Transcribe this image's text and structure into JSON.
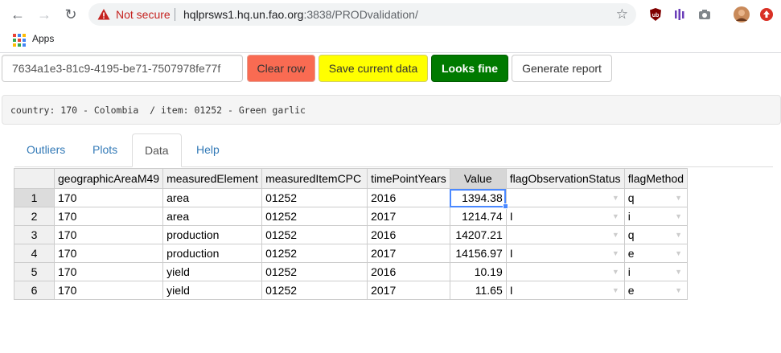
{
  "browser": {
    "security_label": "Not secure",
    "url_host": "hqlprsws1.hq.un.fao.org",
    "url_path": ":3838/PRODvalidation/",
    "bookmarks_apps": "Apps"
  },
  "controls": {
    "record_id": "7634a1e3-81c9-4195-be71-7507978fe77f",
    "clear_row": "Clear row",
    "save_current": "Save current data",
    "looks_fine": "Looks fine",
    "generate_report": "Generate report"
  },
  "info": "country: 170 - Colombia  / item: 01252 - Green garlic",
  "tabs": [
    {
      "label": "Outliers"
    },
    {
      "label": "Plots"
    },
    {
      "label": "Data"
    },
    {
      "label": "Help"
    }
  ],
  "grid": {
    "columns": [
      "geographicAreaM49",
      "measuredElement",
      "measuredItemCPC",
      "timePointYears",
      "Value",
      "flagObservationStatus",
      "flagMethod"
    ],
    "rows": [
      {
        "n": "1",
        "geo": "170",
        "element": "area",
        "cpc": "01252",
        "year": "2016",
        "value": "1394.38",
        "obs": "",
        "method": "q"
      },
      {
        "n": "2",
        "geo": "170",
        "element": "area",
        "cpc": "01252",
        "year": "2017",
        "value": "1214.74",
        "obs": "I",
        "method": "i"
      },
      {
        "n": "3",
        "geo": "170",
        "element": "production",
        "cpc": "01252",
        "year": "2016",
        "value": "14207.21",
        "obs": "",
        "method": "q"
      },
      {
        "n": "4",
        "geo": "170",
        "element": "production",
        "cpc": "01252",
        "year": "2017",
        "value": "14156.97",
        "obs": "I",
        "method": "e"
      },
      {
        "n": "5",
        "geo": "170",
        "element": "yield",
        "cpc": "01252",
        "year": "2016",
        "value": "10.19",
        "obs": "",
        "method": "i"
      },
      {
        "n": "6",
        "geo": "170",
        "element": "yield",
        "cpc": "01252",
        "year": "2017",
        "value": "11.65",
        "obs": "I",
        "method": "e"
      }
    ]
  },
  "colors": {
    "clear_button": "#f96b52",
    "save_button": "#ffff00",
    "looks_fine_button": "#007a00",
    "tab_link": "#337ab7",
    "selection": "#4b89ff"
  }
}
